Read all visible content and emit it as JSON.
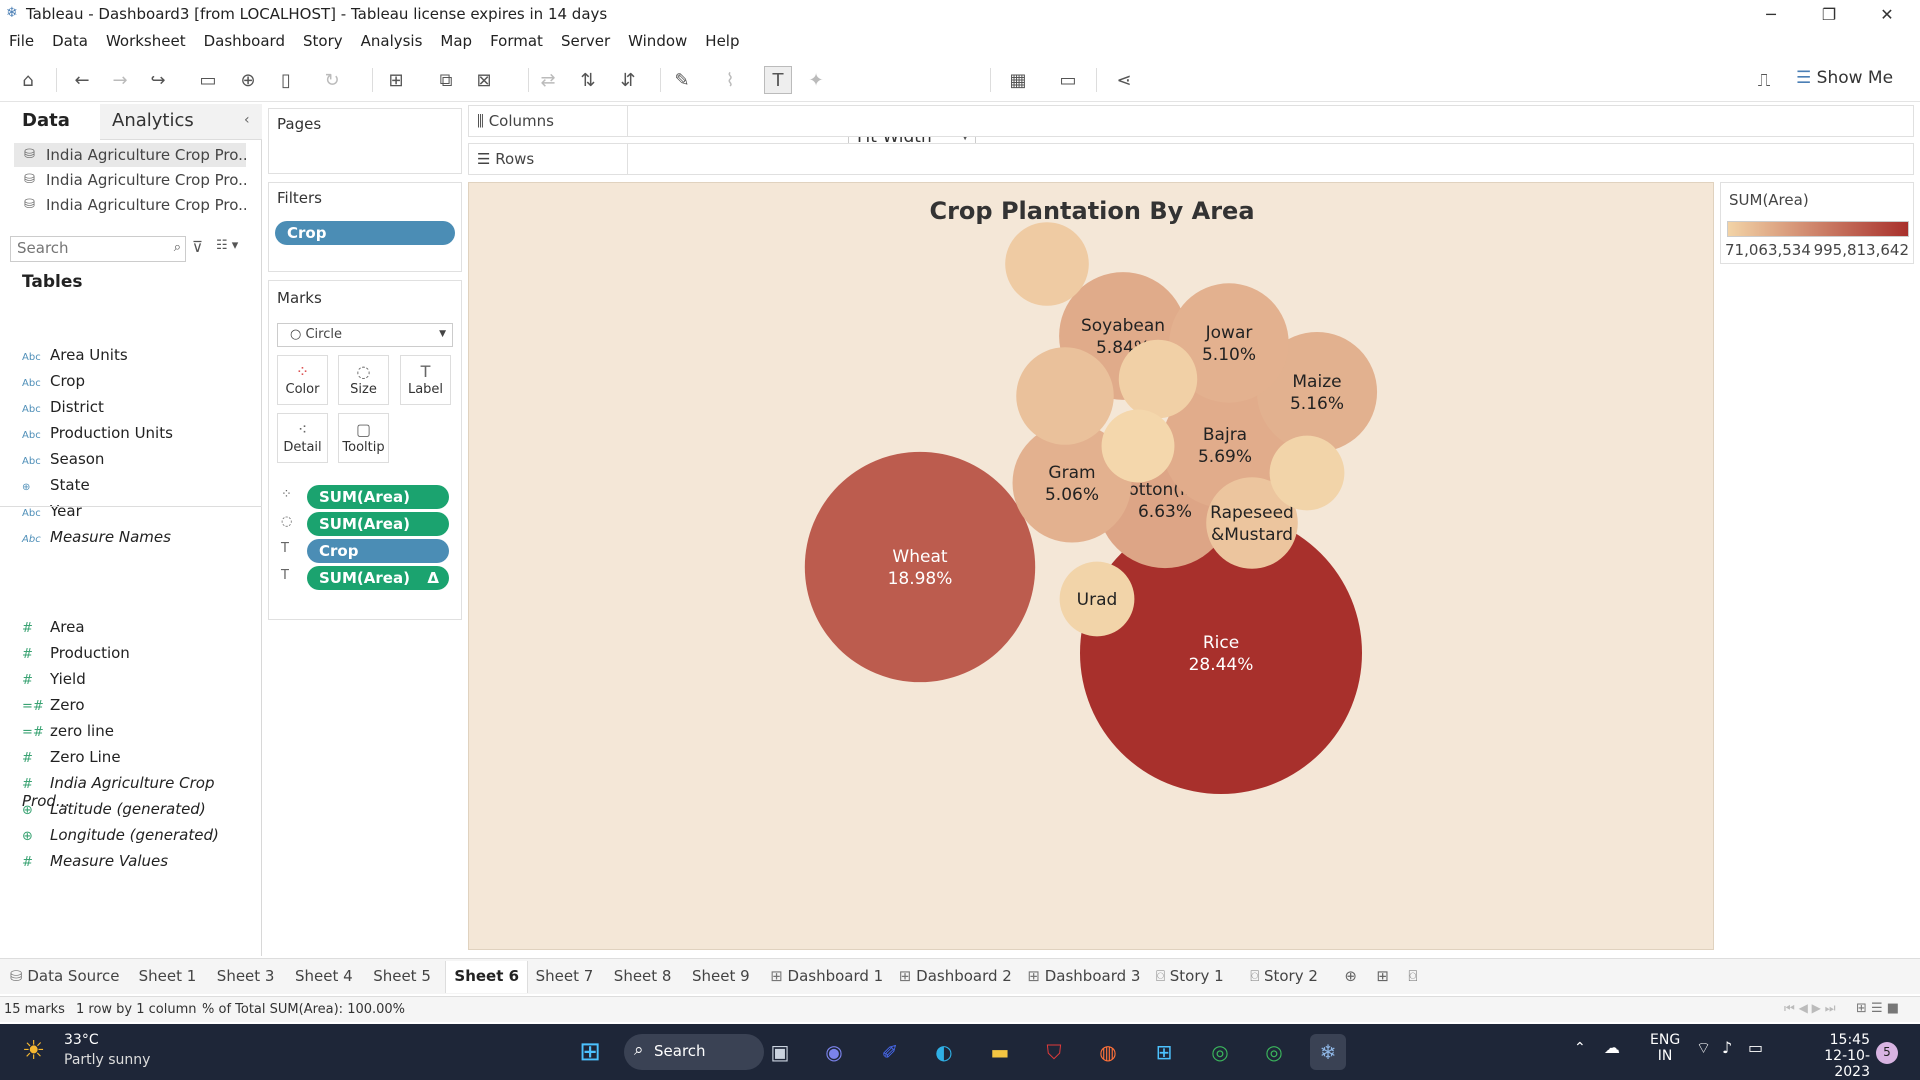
{
  "window": {
    "title": "Tableau - Dashboard3 [from LOCALHOST] - Tableau license expires in 14 days",
    "minimize": "─",
    "restore": "❐",
    "close": "✕"
  },
  "menu": [
    "File",
    "Data",
    "Worksheet",
    "Dashboard",
    "Story",
    "Analysis",
    "Map",
    "Format",
    "Server",
    "Window",
    "Help"
  ],
  "toolbar": {
    "fit": "Fit Width",
    "show_me": "Show Me"
  },
  "left": {
    "tabs": {
      "data": "Data",
      "analytics": "Analytics"
    },
    "datasources": [
      "India Agriculture Crop Pro...",
      "India Agriculture Crop Pro...",
      "India Agriculture Crop Pro..."
    ],
    "search_placeholder": "Search",
    "tables_heading": "Tables",
    "dimensions": [
      {
        "type": "Abc",
        "name": "Area Units",
        "italic": false
      },
      {
        "type": "Abc",
        "name": "Crop",
        "italic": false
      },
      {
        "type": "Abc",
        "name": "District",
        "italic": false
      },
      {
        "type": "Abc",
        "name": "Production Units",
        "italic": false
      },
      {
        "type": "Abc",
        "name": "Season",
        "italic": false
      },
      {
        "type": "⊕",
        "name": "State",
        "italic": false
      },
      {
        "type": "Abc",
        "name": "Year",
        "italic": false
      },
      {
        "type": "Abc",
        "name": "Measure Names",
        "italic": true
      }
    ],
    "measures": [
      {
        "type": "#",
        "name": "Area",
        "italic": false
      },
      {
        "type": "#",
        "name": "Production",
        "italic": false
      },
      {
        "type": "#",
        "name": "Yield",
        "italic": false
      },
      {
        "type": "=#",
        "name": "Zero",
        "italic": false
      },
      {
        "type": "=#",
        "name": "zero line",
        "italic": false
      },
      {
        "type": "#",
        "name": "Zero Line",
        "italic": false
      },
      {
        "type": "#",
        "name": "India Agriculture Crop Prod...",
        "italic": true
      },
      {
        "type": "⊕",
        "name": "Latitude (generated)",
        "italic": true
      },
      {
        "type": "⊕",
        "name": "Longitude (generated)",
        "italic": true
      },
      {
        "type": "#",
        "name": "Measure Values",
        "italic": true
      }
    ]
  },
  "pages": {
    "title": "Pages"
  },
  "filters": {
    "title": "Filters",
    "pills": [
      "Crop"
    ]
  },
  "marks": {
    "title": "Marks",
    "type": "Circle",
    "buttons": [
      "Color",
      "Size",
      "Label",
      "Detail",
      "Tooltip"
    ],
    "pills": [
      {
        "icon": "⁘",
        "label": "SUM(Area)",
        "color": "green",
        "delta": ""
      },
      {
        "icon": "◌",
        "label": "SUM(Area)",
        "color": "green",
        "delta": ""
      },
      {
        "icon": "T",
        "label": "Crop",
        "color": "blue",
        "delta": ""
      },
      {
        "icon": "T",
        "label": "SUM(Area)",
        "color": "green",
        "delta": "Δ"
      }
    ]
  },
  "shelves": {
    "columns": "Columns",
    "rows": "Rows"
  },
  "legend": {
    "title": "SUM(Area)",
    "min_label": "71,063,534",
    "max_label": "995,813,642",
    "color_min": "#f2d3a6",
    "color_max": "#a8302c"
  },
  "chart_data": {
    "type": "packed-bubble",
    "title": "Crop Plantation By Area",
    "measure": "SUM(Area)",
    "label_format": "percent of total",
    "mark_count": 15,
    "bubbles": [
      {
        "crop": "Rice",
        "label": "Rice",
        "pct": "28.44%",
        "share": 28.44
      },
      {
        "crop": "Wheat",
        "label": "Wheat",
        "pct": "18.98%",
        "share": 18.98
      },
      {
        "crop": "Cotton(lint)",
        "label": "Cotton(lint)",
        "pct": "6.63%",
        "share": 6.63
      },
      {
        "crop": "Soyabean",
        "label": "Soyabean",
        "pct": "5.84%",
        "share": 5.84
      },
      {
        "crop": "Bajra",
        "label": "Bajra",
        "pct": "5.69%",
        "share": 5.69
      },
      {
        "crop": "Maize",
        "label": "Maize",
        "pct": "5.16%",
        "share": 5.16
      },
      {
        "crop": "Jowar",
        "label": "Jowar",
        "pct": "5.10%",
        "share": 5.1
      },
      {
        "crop": "Gram",
        "label": "Gram",
        "pct": "5.06%",
        "share": 5.06
      },
      {
        "crop": "Rapeseed &Mustard",
        "label": "Rapeseed &Mustard",
        "pct": "",
        "share": 3.0
      },
      {
        "crop": "Urad",
        "label": "Urad",
        "pct": "",
        "share": 2.0
      },
      {
        "crop": "",
        "label": "",
        "pct": "",
        "share": 3.4
      },
      {
        "crop": "",
        "label": "",
        "pct": "",
        "share": 2.5
      },
      {
        "crop": "",
        "label": "",
        "pct": "",
        "share": 2.2
      },
      {
        "crop": "",
        "label": "",
        "pct": "",
        "share": 1.9
      },
      {
        "crop": "",
        "label": "",
        "pct": "",
        "share": 2.0
      }
    ]
  },
  "tabs": [
    "Data Source",
    "Sheet 1",
    "Sheet 3",
    "Sheet 4",
    "Sheet 5",
    "Sheet 6",
    "Sheet 7",
    "Sheet 8",
    "Sheet 9",
    "Dashboard 1",
    "Dashboard 2",
    "Dashboard 3",
    "Story 1",
    "Story 2"
  ],
  "active_tab": "Sheet 6",
  "status": {
    "marks": "15 marks",
    "dims": "1 row by 1 column",
    "sum": "% of Total SUM(Area): 100.00%"
  },
  "taskbar": {
    "temp": "33°C",
    "weather": "Partly sunny",
    "search": "Search",
    "lang1": "ENG",
    "lang2": "IN",
    "time": "15:45",
    "date": "12-10-2023",
    "badge": "5"
  }
}
